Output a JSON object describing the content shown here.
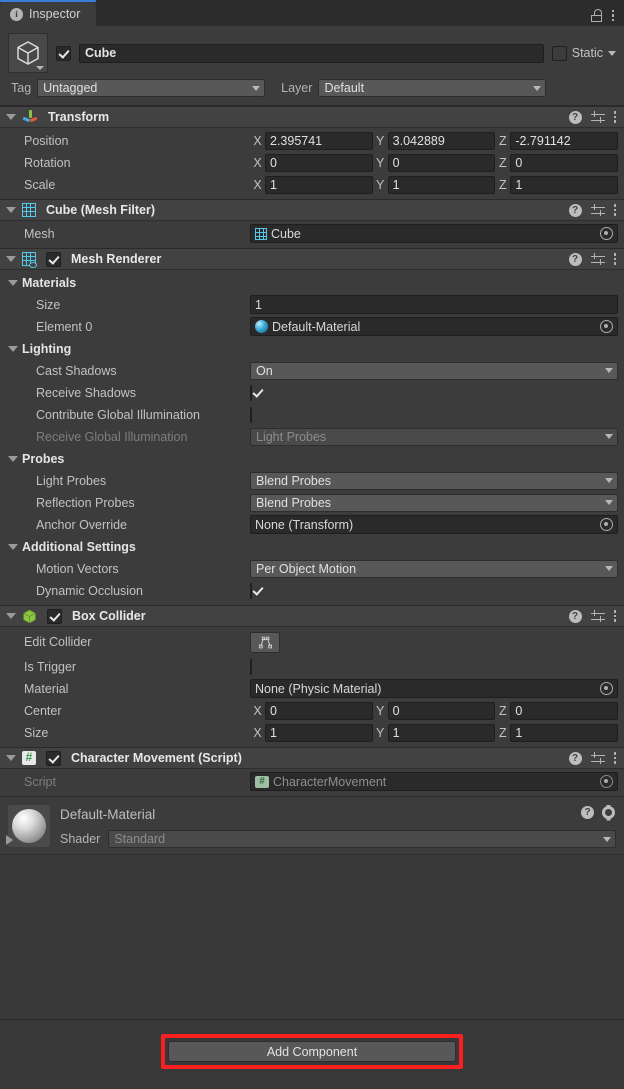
{
  "window": {
    "tab_label": "Inspector",
    "tab_icon": "info-icon",
    "lock_icon": "lock-open-icon",
    "menu_icon": "kebab-menu-icon",
    "accent_color": "#3d7bd9",
    "background_color": "#383838"
  },
  "gameobject": {
    "enabled": true,
    "name": "Cube",
    "name_placeholder": "Name",
    "static_label": "Static",
    "static_checked": false,
    "tag_label": "Tag",
    "tag_value": "Untagged",
    "layer_label": "Layer",
    "layer_value": "Default",
    "thumb_icon": "gameobject-cube-icon"
  },
  "components": [
    {
      "id": "transform",
      "title": "Transform",
      "icon": "transform-gizmo-icon",
      "has_enable_checkbox": false,
      "rows": [
        {
          "label": "Position",
          "axes": [
            "X",
            "Y",
            "Z"
          ],
          "values": [
            "2.395741",
            "3.042889",
            "-2.791142"
          ]
        },
        {
          "label": "Rotation",
          "axes": [
            "X",
            "Y",
            "Z"
          ],
          "values": [
            "0",
            "0",
            "0"
          ]
        },
        {
          "label": "Scale",
          "axes": [
            "X",
            "Y",
            "Z"
          ],
          "values": [
            "1",
            "1",
            "1"
          ]
        }
      ]
    },
    {
      "id": "mesh-filter",
      "title": "Cube (Mesh Filter)",
      "icon": "mesh-filter-grid-icon",
      "has_enable_checkbox": false,
      "mesh_label": "Mesh",
      "mesh_value": "Cube"
    },
    {
      "id": "mesh-renderer",
      "title": "Mesh Renderer",
      "icon": "mesh-renderer-icon",
      "has_enable_checkbox": true,
      "enabled": true,
      "groups": {
        "materials": {
          "label": "Materials",
          "size_label": "Size",
          "size_value": "1",
          "element_label": "Element 0",
          "element_value": "Default-Material"
        },
        "lighting": {
          "label": "Lighting",
          "cast_shadows_label": "Cast Shadows",
          "cast_shadows_value": "On",
          "receive_shadows_label": "Receive Shadows",
          "receive_shadows_checked": true,
          "contribute_gi_label": "Contribute Global Illumination",
          "contribute_gi_checked": false,
          "receive_gi_label": "Receive Global Illumination",
          "receive_gi_value": "Light Probes",
          "receive_gi_disabled": true
        },
        "probes": {
          "label": "Probes",
          "light_probes_label": "Light Probes",
          "light_probes_value": "Blend Probes",
          "reflection_probes_label": "Reflection Probes",
          "reflection_probes_value": "Blend Probes",
          "anchor_override_label": "Anchor Override",
          "anchor_override_value": "None (Transform)"
        },
        "additional": {
          "label": "Additional Settings",
          "motion_vectors_label": "Motion Vectors",
          "motion_vectors_value": "Per Object Motion",
          "dynamic_occlusion_label": "Dynamic Occlusion",
          "dynamic_occlusion_checked": true
        }
      }
    },
    {
      "id": "box-collider",
      "title": "Box Collider",
      "icon": "box-collider-green-cube-icon",
      "has_enable_checkbox": true,
      "enabled": true,
      "edit_collider_label": "Edit Collider",
      "edit_collider_icon": "edit-collider-icon",
      "is_trigger_label": "Is Trigger",
      "is_trigger_checked": false,
      "material_label": "Material",
      "material_value": "None (Physic Material)",
      "center_label": "Center",
      "center_values": [
        "0",
        "0",
        "0"
      ],
      "size_label": "Size",
      "size_values": [
        "1",
        "1",
        "1"
      ],
      "axes": [
        "X",
        "Y",
        "Z"
      ]
    },
    {
      "id": "character-movement",
      "title": "Character Movement (Script)",
      "icon": "csharp-script-icon",
      "has_enable_checkbox": true,
      "enabled": true,
      "script_label": "Script",
      "script_value": "CharacterMovement",
      "script_disabled": true
    }
  ],
  "material_footer": {
    "name": "Default-Material",
    "shader_label": "Shader",
    "shader_value": "Standard",
    "preview_icon": "material-sphere-preview",
    "help_icon": "help-icon",
    "gear_icon": "gear-icon",
    "expand_icon": "triangle-right-icon"
  },
  "add_component": {
    "label": "Add Component",
    "highlighted": true,
    "highlight_color": "#fb2020"
  },
  "icons": {
    "help": "?",
    "info": "i",
    "preset": "preset-icon",
    "kebab": "kebab-menu-icon",
    "target": "object-picker-icon",
    "foldout": "foldout-triangle-icon"
  }
}
